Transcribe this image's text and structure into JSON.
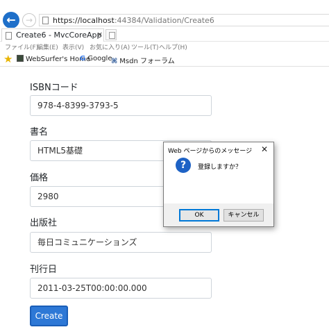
{
  "browser": {
    "url_host": "https://localhost",
    "url_rest": ":44384/Validation/Create6",
    "tab_title": "Create6 - MvcCoreApp",
    "tab_close": "×",
    "menu": [
      "ファイル(F)",
      "編集(E)",
      "表示(V)",
      "お気に入り(A)",
      "ツール(T)",
      "ヘルプ(H)"
    ],
    "favorites": [
      {
        "label": "WebSurfer's Home",
        "icon": "websurfer-icon"
      },
      {
        "label": "Google",
        "icon": "google-icon"
      },
      {
        "label": "Msdn フォーラム",
        "icon": "msdn-icon"
      }
    ]
  },
  "form": {
    "fields": [
      {
        "label": "ISBNコード",
        "value": "978-4-8399-3793-5"
      },
      {
        "label": "書名",
        "value": "HTML5基礎"
      },
      {
        "label": "価格",
        "value": "2980"
      },
      {
        "label": "出版社",
        "value": "毎日コミュニケーションズ"
      },
      {
        "label": "刊行日",
        "value": "2011-03-25T00:00:00.000"
      }
    ],
    "submit_label": "Create"
  },
  "dialog": {
    "title": "Web ページからのメッセージ",
    "close": "✕",
    "icon": "question-icon",
    "message": "登録しますか？",
    "ok_label": "OK",
    "cancel_label": "キャンセル"
  },
  "colors": {
    "primary_button": "#2d78d6",
    "dialog_focus": "#0078d7",
    "question_icon": "#1e62c5"
  }
}
